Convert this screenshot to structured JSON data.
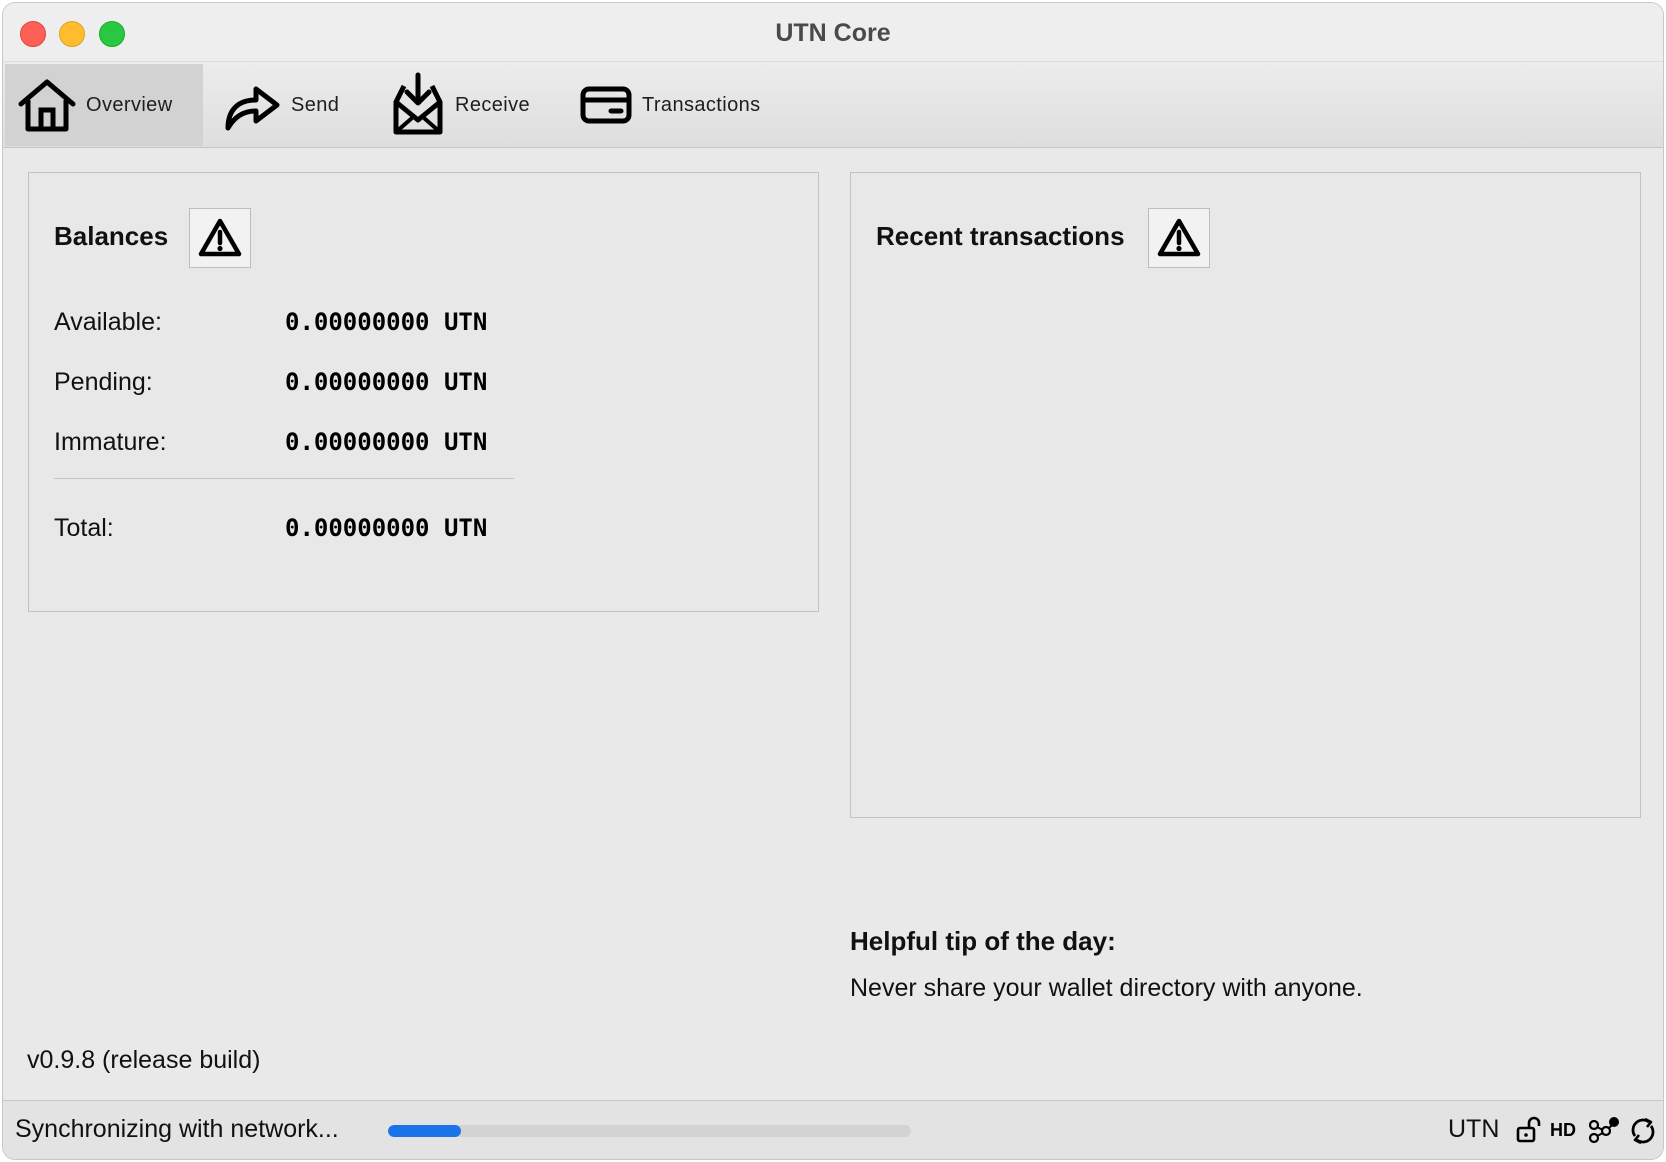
{
  "window": {
    "title": "UTN Core"
  },
  "toolbar": {
    "tabs": [
      {
        "label": "Overview",
        "icon": "home-icon",
        "active": true
      },
      {
        "label": "Send",
        "icon": "send-arrow-icon",
        "active": false
      },
      {
        "label": "Receive",
        "icon": "receive-inbox-icon",
        "active": false
      },
      {
        "label": "Transactions",
        "icon": "card-icon",
        "active": false
      }
    ]
  },
  "balances": {
    "title": "Balances",
    "warning_icon": "warning-triangle-icon",
    "rows": [
      {
        "label": "Available:",
        "value": "0.00000000 UTN"
      },
      {
        "label": "Pending:",
        "value": "0.00000000 UTN"
      },
      {
        "label": "Immature:",
        "value": "0.00000000 UTN"
      }
    ],
    "total": {
      "label": "Total:",
      "value": "0.00000000 UTN"
    }
  },
  "recent_transactions": {
    "title": "Recent transactions",
    "warning_icon": "warning-triangle-icon"
  },
  "tip": {
    "title": "Helpful tip of the day:",
    "text": "Never share your wallet directory with anyone."
  },
  "version": "v0.9.8 (release build)",
  "status_bar": {
    "sync_text": "Synchronizing with network...",
    "sync_progress_fraction": 0.14,
    "unit": "UTN",
    "icons": [
      "lock-open-icon",
      "hd-icon",
      "network-icon",
      "sync-icon"
    ],
    "hd_label": "HD"
  },
  "colors": {
    "progress": "#1a73e8",
    "close": "#fe5f57",
    "minimize": "#febc2e",
    "maximize": "#28c840"
  }
}
